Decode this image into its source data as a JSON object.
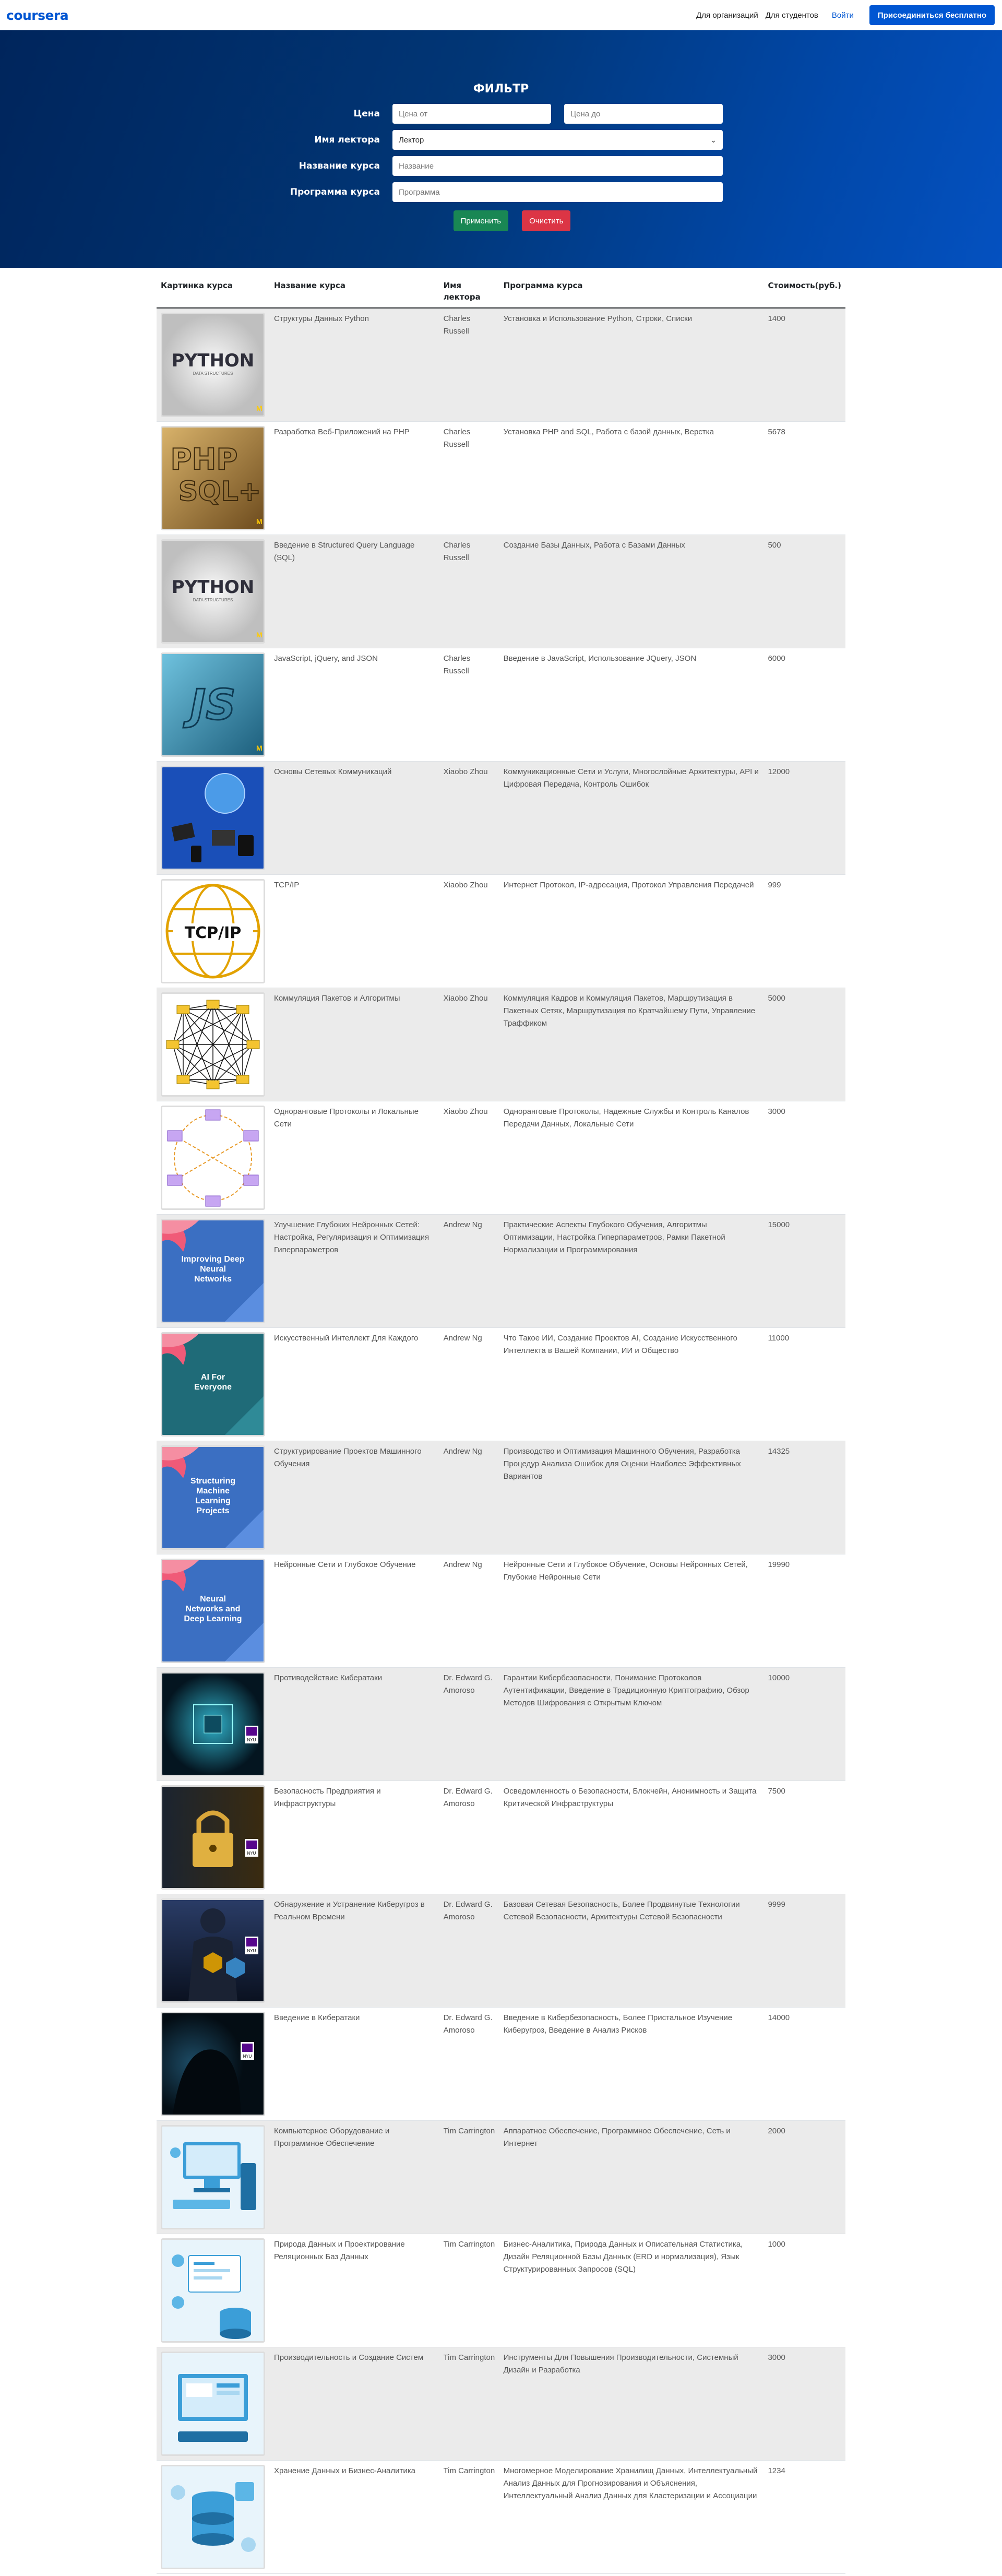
{
  "header": {
    "logo": "coursera",
    "nav": [
      "Для организаций",
      "Для студентов"
    ],
    "login": "Войти",
    "join": "Присоединиться бесплатно"
  },
  "filter": {
    "title": "ФИЛЬТР",
    "price_label": "Цена",
    "price_from_placeholder": "Цена от",
    "price_to_placeholder": "Цена до",
    "lecturer_label": "Имя лектора",
    "lecturer_value": "Лектор",
    "course_name_label": "Название курса",
    "course_name_placeholder": "Название",
    "program_label": "Программа курса",
    "program_placeholder": "Программа",
    "apply": "Применить",
    "clear": "Очистить"
  },
  "table": {
    "headers": [
      "Картинка курса",
      "Название курса",
      "Имя лектора",
      "Программа курса",
      "Стоимость(руб.)"
    ],
    "rows": [
      {
        "name": "Структуры Данных Python",
        "lecturer": "Charles Russell",
        "program": "Установка и Использование Python, Строки, Списки",
        "price": "1400",
        "img": "python"
      },
      {
        "name": "Разработка Веб-Приложений на PHP",
        "lecturer": "Charles Russell",
        "program": "Установка PHP and SQL, Работа с базой данных, Верстка",
        "price": "5678",
        "img": "php"
      },
      {
        "name": "Введение в Structured Query Language (SQL)",
        "lecturer": "Charles Russell",
        "program": "Создание Базы Данных, Работа с Базами Данных",
        "price": "500",
        "img": "python"
      },
      {
        "name": "JavaScript, jQuery, and JSON",
        "lecturer": "Charles Russell",
        "program": "Введение в JavaScript, Использование JQuery, JSON",
        "price": "6000",
        "img": "js"
      },
      {
        "name": "Основы Сетевых Коммуникаций",
        "lecturer": "Xiaobo Zhou",
        "program": "Коммуникационные Сети и Услуги, Многослойные Архитектуры, API и Цифровая Передача, Контроль Ошибок",
        "price": "12000",
        "img": "network"
      },
      {
        "name": "TCP/IP",
        "lecturer": "Xiaobo Zhou",
        "program": "Интернет Протокол, IP-адресация, Протокол Управления Передачей",
        "price": "999",
        "img": "tcpip"
      },
      {
        "name": "Коммуляция Пакетов и Алгоритмы",
        "lecturer": "Xiaobo Zhou",
        "program": "Коммуляция Кадров и Коммуляция Пакетов, Маршрутизация в Пакетных Сетях, Маршрутизация по Кратчайшему Пути, Управление Траффиком",
        "price": "5000",
        "img": "mesh"
      },
      {
        "name": "Одноранговые Протоколы и Локальные Сети",
        "lecturer": "Xiaobo Zhou",
        "program": "Одноранговые Протоколы, Надежные Службы и Контроль Каналов Передачи Данных, Локальные Сети",
        "price": "3000",
        "img": "ring"
      },
      {
        "name": "Улучшение Глубоких Нейронных Сетей: Настройка, Регуляризация и Оптимизация Гиперпараметров",
        "lecturer": "Andrew Ng",
        "program": "Практические Аспекты Глубокого Обучения, Алгоритмы Оптимизации, Настройка Гиперпараметров, Рамки Пакетной Нормализации и Программирования",
        "price": "15000",
        "img": "dl1",
        "card_text": "Improving Deep Neural Networks"
      },
      {
        "name": "Искусственный Интеллект Для Каждого",
        "lecturer": "Andrew Ng",
        "program": "Что Такое ИИ, Создание Проектов AI, Создание Искусственного Интеллекта в Вашей Компании, ИИ и Общество",
        "price": "11000",
        "img": "dl2",
        "card_text": "AI For Everyone"
      },
      {
        "name": "Структурирование Проектов Машинного Обучения",
        "lecturer": "Andrew Ng",
        "program": "Производство и Оптимизация Машинного Обучения, Разработка Процедур Анализа Ошибок для Оценки Наиболее Эффективных Вариантов",
        "price": "14325",
        "img": "dl3",
        "card_text": "Structuring Machine Learning Projects"
      },
      {
        "name": "Нейронные Сети и Глубокое Обучение",
        "lecturer": "Andrew Ng",
        "program": "Нейронные Сети и Глубокое Обучение, Основы Нейронных Сетей, Глубокие Нейронные Сети",
        "price": "19990",
        "img": "dl4",
        "card_text": "Neural Networks and Deep Learning"
      },
      {
        "name": "Противодействие Кибератаки",
        "lecturer": "Dr. Edward G. Amoroso",
        "program": "Гарантии Кибербезопасности, Понимание Протоколов Аутентификации, Введение в Традиционную Криптографию, Обзор Методов Шифрования с Открытым Ключом",
        "price": "10000",
        "img": "cyber1"
      },
      {
        "name": "Безопасность Предприятия и Инфраструктуры",
        "lecturer": "Dr. Edward G. Amoroso",
        "program": "Осведомленность о Безопасности, Блокчейн, Анонимность и Защита Критической Инфраструктуры",
        "price": "7500",
        "img": "cyber2"
      },
      {
        "name": "Обнаружение и Устранение Киберугроз в Реальном Времени",
        "lecturer": "Dr. Edward G. Amoroso",
        "program": "Базовая Сетевая Безопасность, Более Продвинутые Технологии Сетевой Безопасности, Архитектуры Сетевой Безопасности",
        "price": "9999",
        "img": "cyber3"
      },
      {
        "name": "Введение в Кибератаки",
        "lecturer": "Dr. Edward G. Amoroso",
        "program": "Введение в Кибербезопасность, Более Пристальное Изучение Киберугроз, Введение в Анализ Рисков",
        "price": "14000",
        "img": "cyber4"
      },
      {
        "name": "Компьютерное Оборудование и Программное Обеспечение",
        "lecturer": "Tim Carrington",
        "program": "Аппаратное Обеспечение, Программное Обеспечение, Сеть и Интернет",
        "price": "2000",
        "img": "it1"
      },
      {
        "name": "Природа Данных и Проектирование Реляционных Баз Данных",
        "lecturer": "Tim Carrington",
        "program": "Бизнес-Аналитика, Природа Данных и Описательная Статистика, Дизайн Реляционной Базы Данных (ERD и нормализация), Язык Структурированных Запросов (SQL)",
        "price": "1000",
        "img": "it2"
      },
      {
        "name": "Производительность и Создание Систем",
        "lecturer": "Tim Carrington",
        "program": "Инструменты Для Повышения Производительности, Системный Дизайн и Разработка",
        "price": "3000",
        "img": "it3"
      },
      {
        "name": "Хранение Данных и Бизнес-Аналитика",
        "lecturer": "Tim Carrington",
        "program": "Многомерное Моделирование Хранилищ Данных, Интеллектуальный Анализ Данных для Прогнозирования и Объяснения, Интеллектуальный Анализ Данных для Кластеризации и Ассоциации",
        "price": "1234",
        "img": "it4"
      }
    ]
  },
  "image_text": {
    "python": "PYTHON",
    "python_sub": "DATA STRUCTURES",
    "php": "PHP",
    "sql": "SQL+",
    "js": "JS",
    "tcpip": "TCP/IP",
    "nyu": "NYU",
    "umich": "M"
  },
  "colors": {
    "brand": "#0056d2",
    "apply": "#198754",
    "clear": "#dc3545",
    "stripe": "#ebebeb"
  }
}
